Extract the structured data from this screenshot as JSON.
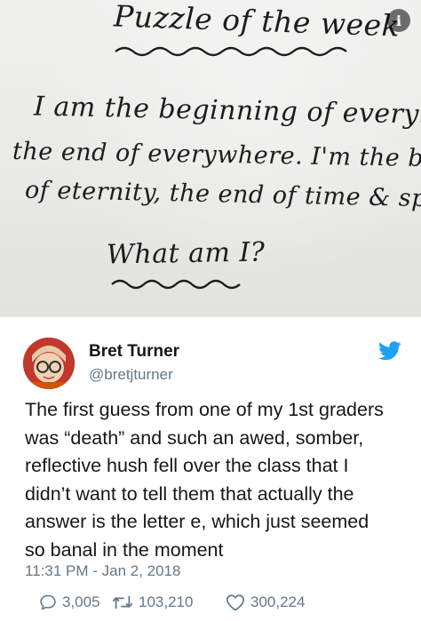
{
  "photo": {
    "title": "Puzzle of the week",
    "line1": "I am the beginning of everything,",
    "line2": "the end of everywhere. I'm the beginning",
    "line3": "of eternity, the end of time & space.",
    "question": "What am I?"
  },
  "tweet": {
    "author_name": "Bret Turner",
    "author_handle": "@bretjturner",
    "text_lines": [
      "The first guess from one of my 1st graders",
      "was “death” and such an awed, somber,",
      "reflective hush fell over the class that I",
      "didn’t want to tell them that actually the",
      "answer is the letter e, which just seemed",
      "so banal in the moment"
    ],
    "timestamp": "11:31 PM - Jan 2, 2018",
    "replies": "3,005",
    "retweets": "103,210",
    "likes": "300,224"
  },
  "colors": {
    "twitter_blue": "#1da1f2",
    "secondary_text": "#657786",
    "primary_text": "#14171a"
  },
  "icons": [
    "info-icon",
    "twitter-bird-icon",
    "reply-icon",
    "retweet-icon",
    "like-icon"
  ]
}
